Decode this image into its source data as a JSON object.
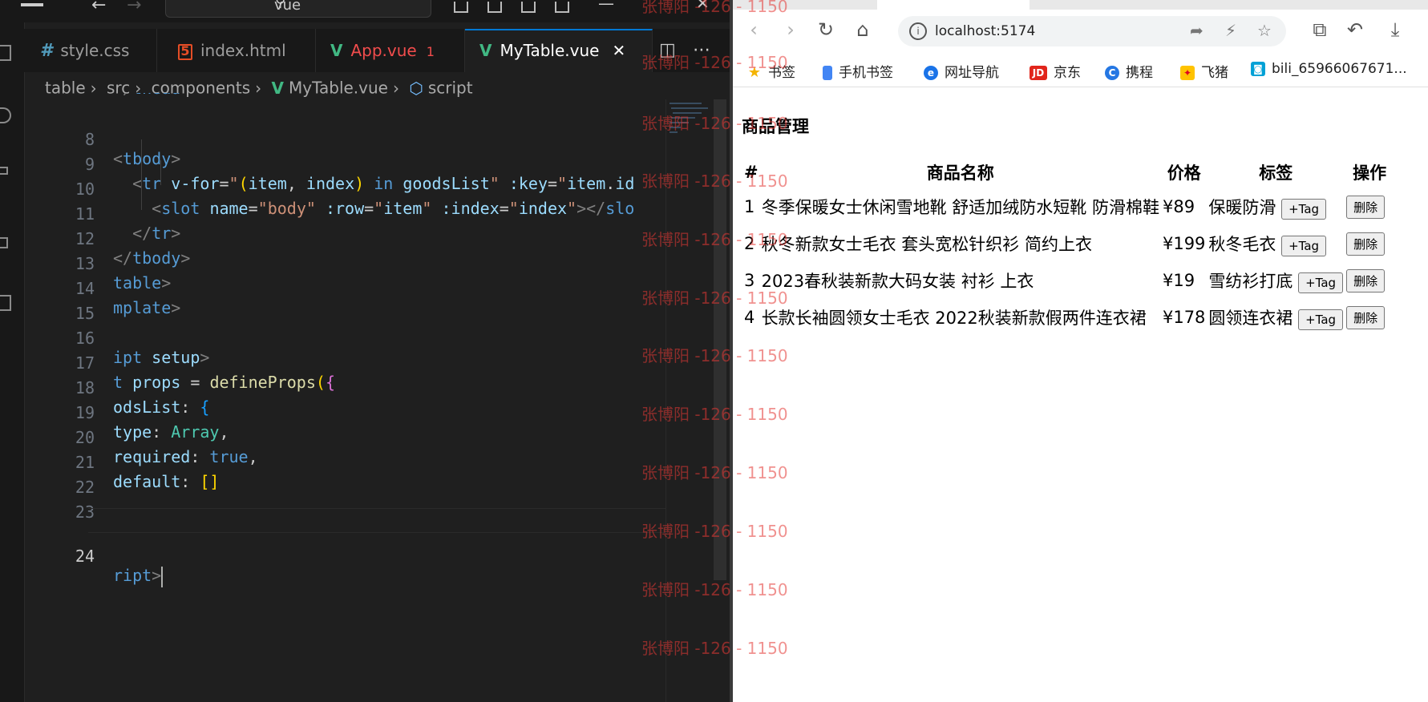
{
  "editor": {
    "search_text": "vue",
    "tabs": [
      {
        "label": "style.css",
        "kind": "css"
      },
      {
        "label": "index.html",
        "kind": "html"
      },
      {
        "label": "App.vue",
        "kind": "vue",
        "badge": "1"
      },
      {
        "label": "MyTable.vue",
        "kind": "vue",
        "active": true
      }
    ],
    "breadcrumb": [
      "table",
      "src",
      "components",
      "MyTable.vue",
      "script"
    ],
    "lines": [
      {
        "num": "8",
        "code": "<tbody>"
      },
      {
        "num": "9",
        "code": "  <tr v-for=\"(item, index) in goodsList\" :key=\"item.id"
      },
      {
        "num": "10",
        "code": "    <slot name=\"body\" :row=\"item\" :index=\"index\"></slo"
      },
      {
        "num": "11",
        "code": "  </tr>"
      },
      {
        "num": "12",
        "code": "</tbody>"
      },
      {
        "num": "13",
        "code": "table>"
      },
      {
        "num": "14",
        "code": "mplate>"
      },
      {
        "num": "15",
        "code": ""
      },
      {
        "num": "16",
        "code": "ipt setup>"
      },
      {
        "num": "17",
        "code": "t props = defineProps({"
      },
      {
        "num": "18",
        "code": "odsList: {"
      },
      {
        "num": "19",
        "code": "type: Array,"
      },
      {
        "num": "20",
        "code": "required: true,"
      },
      {
        "num": "21",
        "code": "default: []"
      },
      {
        "num": "22",
        "code": ""
      },
      {
        "num": "23",
        "code": ""
      },
      {
        "num": "24",
        "code": "ript>"
      }
    ],
    "current_line": "24"
  },
  "watermark": "张博阳 -126 - 1150",
  "browser": {
    "url": "localhost:5174",
    "bookmarks": [
      "书签",
      "手机书签",
      "网址导航",
      "京东",
      "携程",
      "飞猪",
      "bili_65966067671..."
    ],
    "page_title": "商品管理",
    "table_headers": [
      "#",
      "商品名称",
      "价格",
      "标签",
      "操作"
    ],
    "rows": [
      {
        "id": "1",
        "name": "冬季保暖女士休闲雪地靴 舒适加绒防水短靴 防滑棉鞋",
        "price": "¥89",
        "tag": "保暖防滑"
      },
      {
        "id": "2",
        "name": "秋冬新款女士毛衣 套头宽松针织衫 简约上衣",
        "price": "¥199",
        "tag": "秋冬毛衣"
      },
      {
        "id": "3",
        "name": "2023春秋装新款大码女装 衬衫 上衣",
        "price": "¥19",
        "tag": "雪纺衫打底"
      },
      {
        "id": "4",
        "name": "长款长袖圆领女士毛衣 2022秋装新款假两件连衣裙",
        "price": "¥178",
        "tag": "圆领连衣裙"
      }
    ],
    "add_tag_label": "+Tag",
    "delete_label": "删除"
  },
  "colors": {
    "accent": "#0078d4",
    "vue_green": "#41b883",
    "error_red": "#f14c4c"
  }
}
